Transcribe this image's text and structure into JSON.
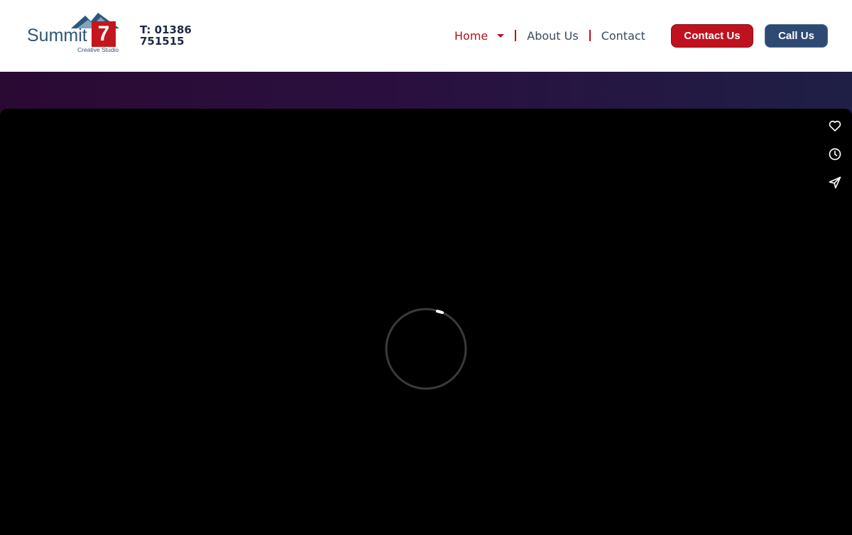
{
  "brand": {
    "name": "Summit",
    "number": "7",
    "tagline": "Creative Studio",
    "colors": {
      "blue": "#2c5777",
      "red": "#c4161c"
    }
  },
  "phone": {
    "text": "T: 01386 751515"
  },
  "nav": {
    "items": [
      {
        "label": "Home",
        "active": true,
        "has_dropdown": true
      },
      {
        "label": "About Us",
        "active": false
      },
      {
        "label": "Contact",
        "active": false
      }
    ]
  },
  "buttons": {
    "contact_label": "Contact Us",
    "call_label": "Call Us"
  },
  "video": {
    "state": "loading",
    "actions": [
      {
        "icon": "heart-icon"
      },
      {
        "icon": "clock-icon"
      },
      {
        "icon": "share-icon"
      }
    ]
  }
}
